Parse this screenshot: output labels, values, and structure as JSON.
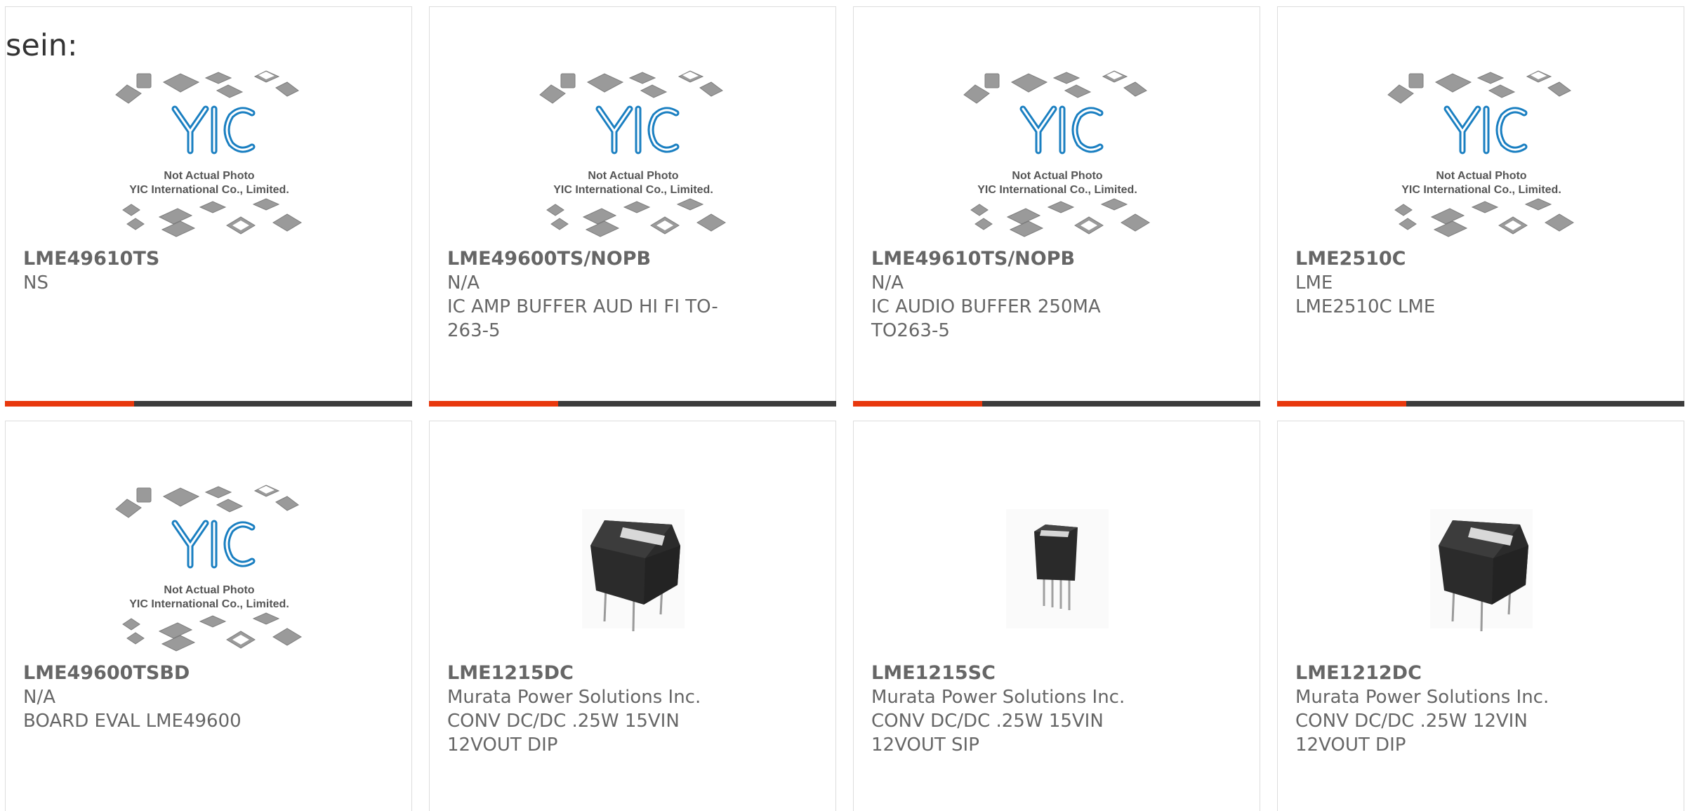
{
  "intro_text": "sein:",
  "colors": {
    "accent_red": "#e8380d",
    "accent_dark": "#3c3c3c",
    "text_gray": "#666666",
    "yic_logo_blue": "#1a7fc1"
  },
  "placeholder": {
    "logo": "YIC",
    "line1": "Not Actual Photo",
    "line2": "YIC International Co., Limited."
  },
  "products": [
    {
      "name": "LME49610TS",
      "manufacturer": "NS",
      "description": "",
      "image": "placeholder"
    },
    {
      "name": "LME49600TS/NOPB",
      "manufacturer": "N/A",
      "description": "IC AMP BUFFER AUD HI FI TO-263-5",
      "image": "placeholder"
    },
    {
      "name": "LME49610TS/NOPB",
      "manufacturer": "N/A",
      "description": "IC AUDIO BUFFER 250MA TO263-5",
      "image": "placeholder"
    },
    {
      "name": "LME2510C",
      "manufacturer": "LME",
      "description": "LME2510C LME",
      "image": "placeholder"
    },
    {
      "name": "LME49600TSBD",
      "manufacturer": "N/A",
      "description": "BOARD EVAL LME49600",
      "image": "placeholder"
    },
    {
      "name": "LME1215DC",
      "manufacturer": "Murata Power Solutions Inc.",
      "description": "CONV DC/DC .25W 15VIN 12VOUT DIP",
      "image": "dip-module"
    },
    {
      "name": "LME1215SC",
      "manufacturer": "Murata Power Solutions Inc.",
      "description": "CONV DC/DC .25W 15VIN 12VOUT SIP",
      "image": "sip-module"
    },
    {
      "name": "LME1212DC",
      "manufacturer": "Murata Power Solutions Inc.",
      "description": "CONV DC/DC .25W 12VIN 12VOUT DIP",
      "image": "dip-module"
    }
  ]
}
